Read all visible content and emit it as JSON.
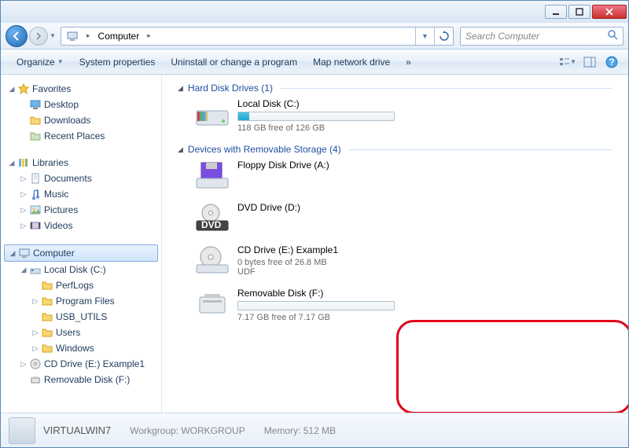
{
  "titlebar": {},
  "nav": {
    "breadcrumb": [
      "Computer"
    ],
    "search_placeholder": "Search Computer"
  },
  "toolbar": {
    "organize": "Organize",
    "sys_props": "System properties",
    "uninstall": "Uninstall or change a program",
    "map_drive": "Map network drive",
    "more": "»"
  },
  "tree": {
    "favorites": {
      "label": "Favorites",
      "items": [
        "Desktop",
        "Downloads",
        "Recent Places"
      ]
    },
    "libraries": {
      "label": "Libraries",
      "items": [
        "Documents",
        "Music",
        "Pictures",
        "Videos"
      ]
    },
    "computer": {
      "label": "Computer",
      "localdisk": "Local Disk (C:)",
      "localdisk_children": [
        "PerfLogs",
        "Program Files",
        "USB_UTILS",
        "Users",
        "Windows"
      ],
      "cd": "CD Drive (E:) Example1",
      "removable": "Removable Disk (F:)"
    }
  },
  "content": {
    "group1": {
      "title": "Hard Disk Drives (1)",
      "drive1": {
        "name": "Local Disk (C:)",
        "free": "118 GB free of 126 GB",
        "fill_pct": 7
      }
    },
    "group2": {
      "title": "Devices with Removable Storage (4)",
      "floppy": {
        "name": "Floppy Disk Drive (A:)"
      },
      "dvd": {
        "name": "DVD Drive (D:)"
      },
      "cd": {
        "name": "CD Drive (E:) Example1",
        "free": "0 bytes free of 26.8 MB",
        "fs": "UDF"
      },
      "rem": {
        "name": "Removable Disk (F:)",
        "free": "7.17 GB free of 7.17 GB",
        "fill_pct": 0
      }
    }
  },
  "status": {
    "name": "VIRTUALWIN7",
    "wg_label": "Workgroup:",
    "wg": "WORKGROUP",
    "mem_label": "Memory:",
    "mem": "512 MB"
  }
}
